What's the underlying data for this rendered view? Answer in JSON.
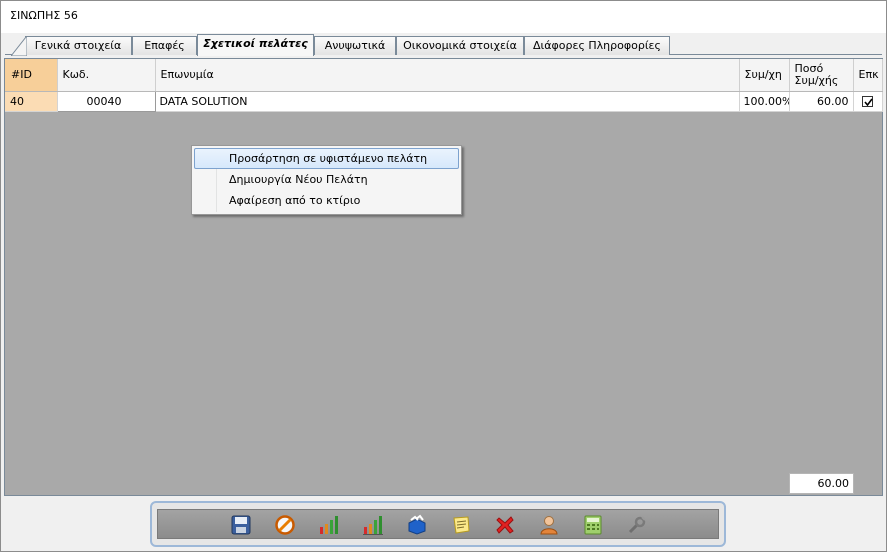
{
  "window": {
    "title": "ΣΙΝΩΠΗΣ 56"
  },
  "tabs": [
    {
      "label": "Γενικά στοιχεία",
      "active": false
    },
    {
      "label": "Επαφές",
      "active": false
    },
    {
      "label": "Σχετικοί πελάτες",
      "active": true
    },
    {
      "label": "Ανυψωτικά",
      "active": false
    },
    {
      "label": "Οικονομικά στοιχεία",
      "active": false
    },
    {
      "label": "Διάφορες Πληροφορίες",
      "active": false
    }
  ],
  "grid": {
    "columns": {
      "id": "#ID",
      "code": "Κωδ.",
      "name": "Επωνυμία",
      "share": "Συμ/χη",
      "amount_line1": "Ποσό",
      "amount_line2": "Συμ/χής",
      "check": "Επκ"
    },
    "rows": [
      {
        "id": "40",
        "code": "00040",
        "name": "DATA SOLUTION",
        "share": "100.00%",
        "amount": "60.00",
        "checked": true
      }
    ]
  },
  "context_menu": {
    "items": [
      {
        "label": "Προσάρτηση σε υφιστάμενο πελάτη",
        "highlighted": true
      },
      {
        "label": "Δημιουργία Νέου Πελάτη",
        "highlighted": false
      },
      {
        "label": "Αφαίρεση από το κτίριο",
        "highlighted": false
      }
    ]
  },
  "footer": {
    "total": "60.00"
  },
  "toolbar": {
    "buttons": [
      "save-icon",
      "cancel-icon",
      "bar-chart-icon",
      "bar-chart-alt-icon",
      "box-icon",
      "notes-icon",
      "delete-icon",
      "user-icon",
      "calculator-icon",
      "tools-icon"
    ]
  },
  "colors": {
    "grid_background": "#a9a9a9",
    "id_header": "#f7cf99",
    "id_cell": "#fbdcb4",
    "menu_highlight": "#d6e8fb",
    "toolbar_border": "#9db8d8"
  }
}
